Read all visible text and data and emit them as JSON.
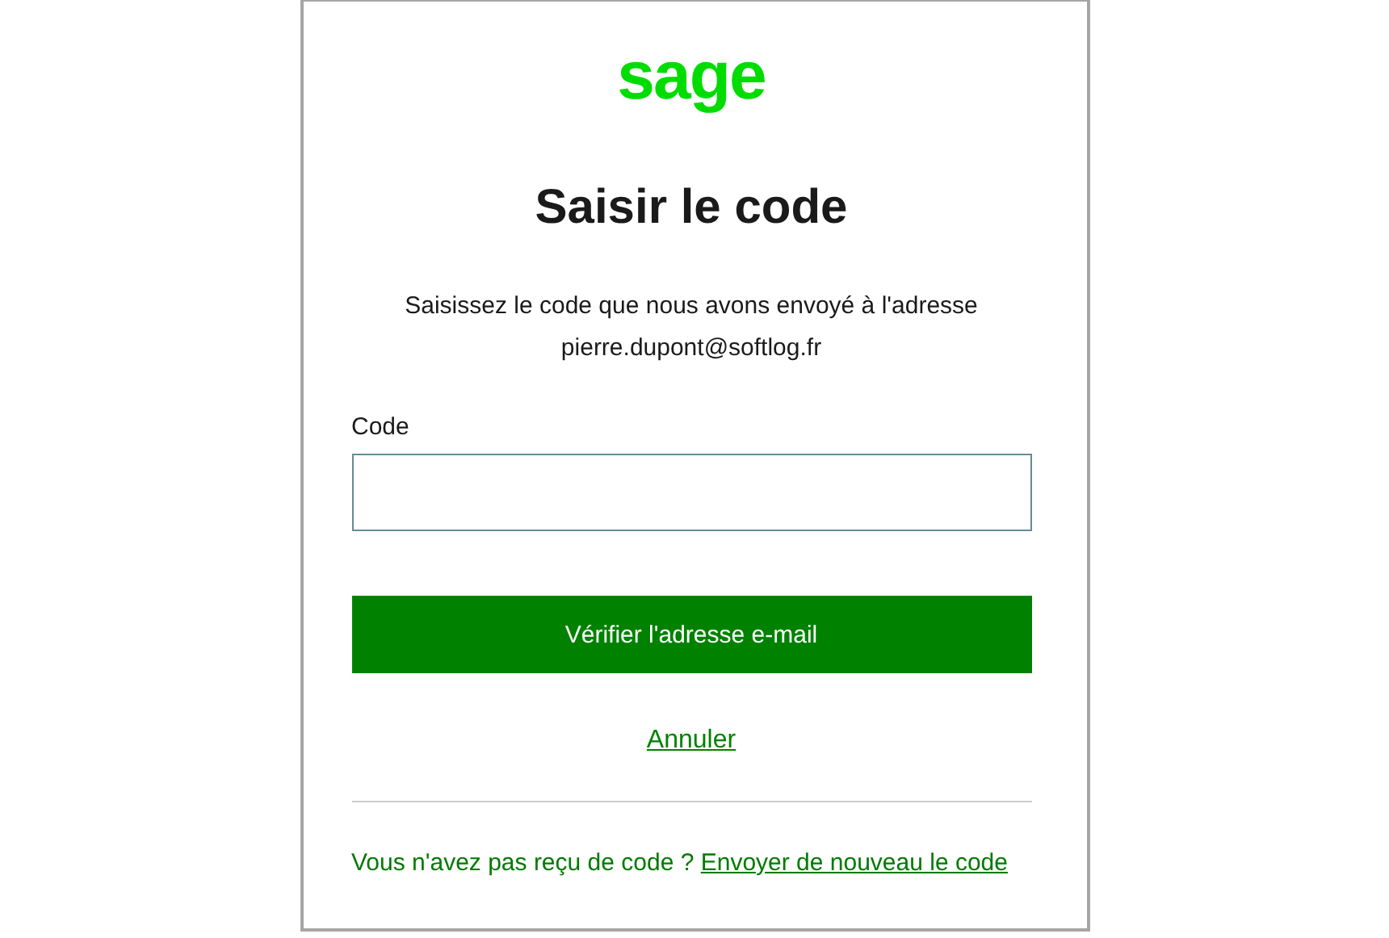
{
  "logo": "sage",
  "title": "Saisir le code",
  "description": [
    "Saisissez le code que nous avons envoyé à l'adresse",
    "pierre.dupont@softlog.fr"
  ],
  "field": {
    "label": "Code"
  },
  "primary_button": "Vérifier l'adresse e-mail",
  "cancel_link": "Annuler",
  "footer": {
    "text": "Vous n'avez pas reçu de code ?",
    "link": "Envoyer de nouveau le code"
  }
}
